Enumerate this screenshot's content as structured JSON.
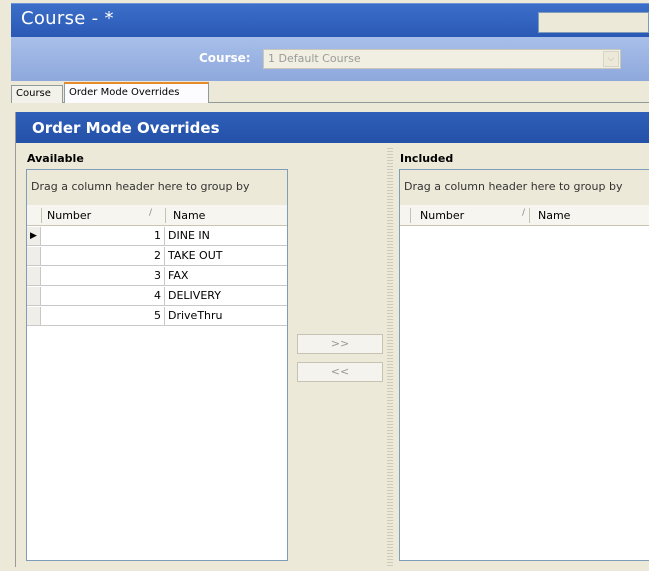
{
  "window": {
    "title": "Course - *"
  },
  "course_row": {
    "label": "Course:",
    "selected_value": "1 Default Course",
    "dropdown_glyph": "⌵"
  },
  "tabs": [
    {
      "label": "Course",
      "active": false
    },
    {
      "label": "Order Mode Overrides",
      "active": true
    }
  ],
  "panel": {
    "title": "Order Mode Overrides"
  },
  "available": {
    "title": "Available",
    "group_by_text": "Drag a column header here to group by",
    "columns": [
      "Number",
      "Name"
    ],
    "sort_glyph": "/",
    "current_row_glyph": "▶",
    "rows": [
      {
        "number": "1",
        "name": "DINE IN"
      },
      {
        "number": "2",
        "name": "TAKE OUT"
      },
      {
        "number": "3",
        "name": "FAX"
      },
      {
        "number": "4",
        "name": "DELIVERY"
      },
      {
        "number": "5",
        "name": "DriveThru"
      }
    ]
  },
  "buttons": {
    "add": ">>",
    "remove": "<<"
  },
  "included": {
    "title": "Included",
    "group_by_text": "Drag a column header here to group by",
    "columns": [
      "Number",
      "Name"
    ],
    "sort_glyph": "/"
  },
  "colors": {
    "titlebar": "#2a59b5",
    "panel_header": "#2451a8",
    "active_tab_accent": "#e68b2c"
  }
}
